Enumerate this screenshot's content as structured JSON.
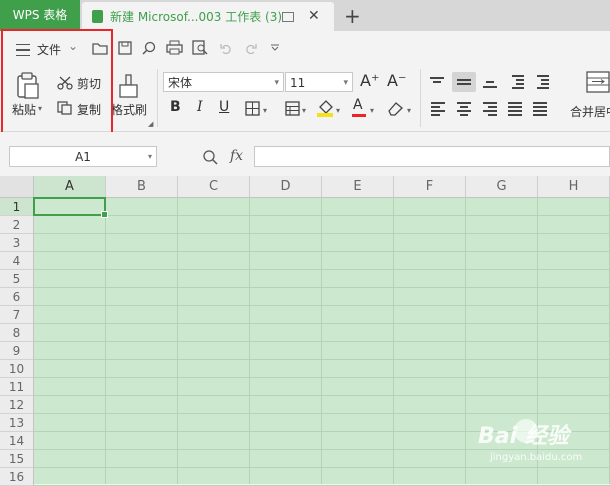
{
  "titlebar": {
    "app_tab": "WPS 表格",
    "doc_tab": "新建 Microsof...003 工作表 (3)",
    "close": "✕",
    "new_tab": "+"
  },
  "ribbon": {
    "file_menu": "文件",
    "file_arrow": "⌄",
    "paste_label": "粘贴",
    "cut_label": "剪切",
    "copy_label": "复制",
    "format_painter_label": "格式刷",
    "font_name": "宋体",
    "font_size": "11",
    "grow_font": "A⁺",
    "shrink_font": "A⁻",
    "bold": "B",
    "italic": "I",
    "underline": "U",
    "font_color": "A",
    "merge_label": "合并居中"
  },
  "formula": {
    "name_box": "A1",
    "fx": "fx"
  },
  "grid": {
    "columns": [
      "A",
      "B",
      "C",
      "D",
      "E",
      "F",
      "G",
      "H"
    ],
    "rows": [
      "1",
      "2",
      "3",
      "4",
      "5",
      "6",
      "7",
      "8",
      "9",
      "10",
      "11",
      "12",
      "13",
      "14",
      "15",
      "16"
    ],
    "selected_cell": "A1"
  },
  "watermark": {
    "text": "Bai 经验",
    "sub": "jingyan.baidu.com"
  },
  "colors": {
    "accent": "#3f9f4b",
    "highlight": "#e8262b",
    "sheet_bg": "#cce8cf"
  }
}
